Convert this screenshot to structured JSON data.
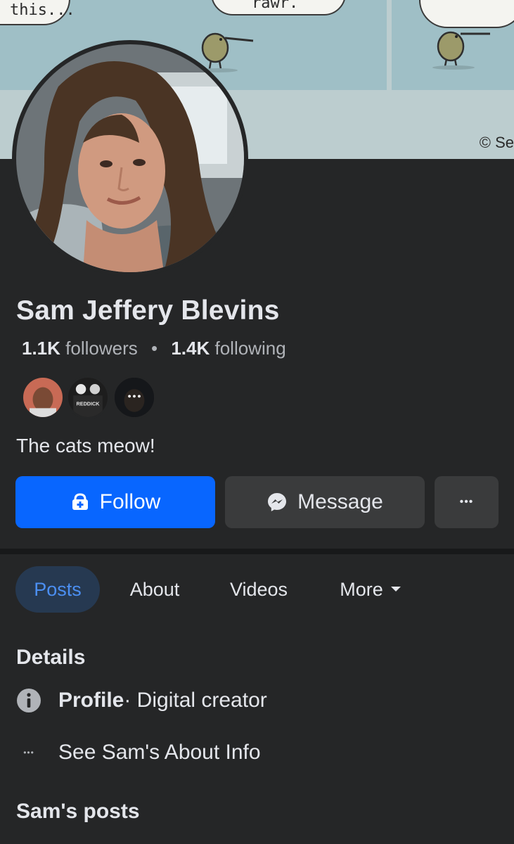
{
  "cover": {
    "caption_left": "this...",
    "caption_mid": "rawr.",
    "copyright": "© Se"
  },
  "profile": {
    "name": "Sam Jeffery Blevins",
    "followers_count": "1.1K",
    "followers_label": "followers",
    "separator": "•",
    "following_count": "1.4K",
    "following_label": "following",
    "mutual_avatar_text": "REDDICK",
    "mutual_more": "•••",
    "bio": "The cats meow!"
  },
  "actions": {
    "follow_label": "Follow",
    "message_label": "Message",
    "more_label": "•••"
  },
  "tabs": [
    {
      "label": "Posts",
      "active": true
    },
    {
      "label": "About",
      "active": false
    },
    {
      "label": "Videos",
      "active": false
    },
    {
      "label": "More",
      "active": false
    }
  ],
  "details": {
    "heading": "Details",
    "profile_label": "Profile",
    "profile_value": " · Digital creator",
    "about_link": "See Sam's About Info",
    "about_icon": "•••"
  },
  "posts_heading": "Sam's posts",
  "colors": {
    "background": "#252627",
    "accent": "#0866ff",
    "tab_active_bg": "#263951",
    "tab_active_text": "#4b8ff2",
    "secondary_button": "#3a3b3c"
  }
}
